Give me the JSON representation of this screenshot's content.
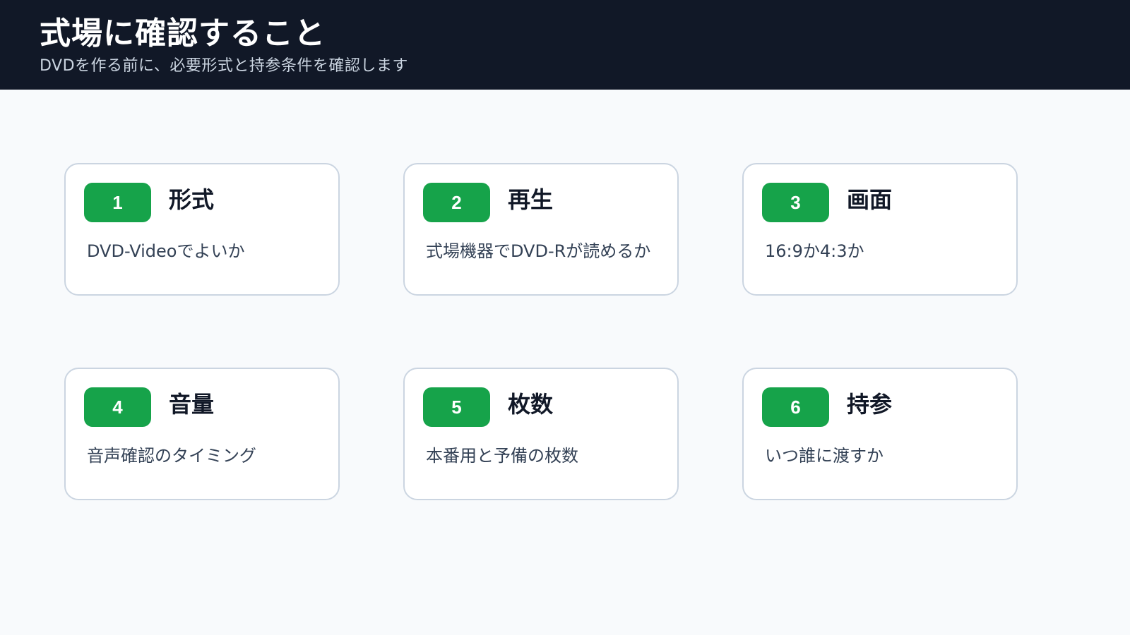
{
  "header": {
    "title": "式場に確認すること",
    "subtitle": "DVDを作る前に、必要形式と持参条件を確認します"
  },
  "colors": {
    "header_bg": "#111827",
    "badge": "#16a34a",
    "background": "#f8fafc"
  },
  "cards": [
    {
      "number": "1",
      "title": "形式",
      "description": "DVD-Videoでよいか"
    },
    {
      "number": "2",
      "title": "再生",
      "description": "式場機器でDVD-Rが読めるか"
    },
    {
      "number": "3",
      "title": "画面",
      "description": "16:9か4:3か"
    },
    {
      "number": "4",
      "title": "音量",
      "description": "音声確認のタイミング"
    },
    {
      "number": "5",
      "title": "枚数",
      "description": "本番用と予備の枚数"
    },
    {
      "number": "6",
      "title": "持参",
      "description": "いつ誰に渡すか"
    }
  ]
}
